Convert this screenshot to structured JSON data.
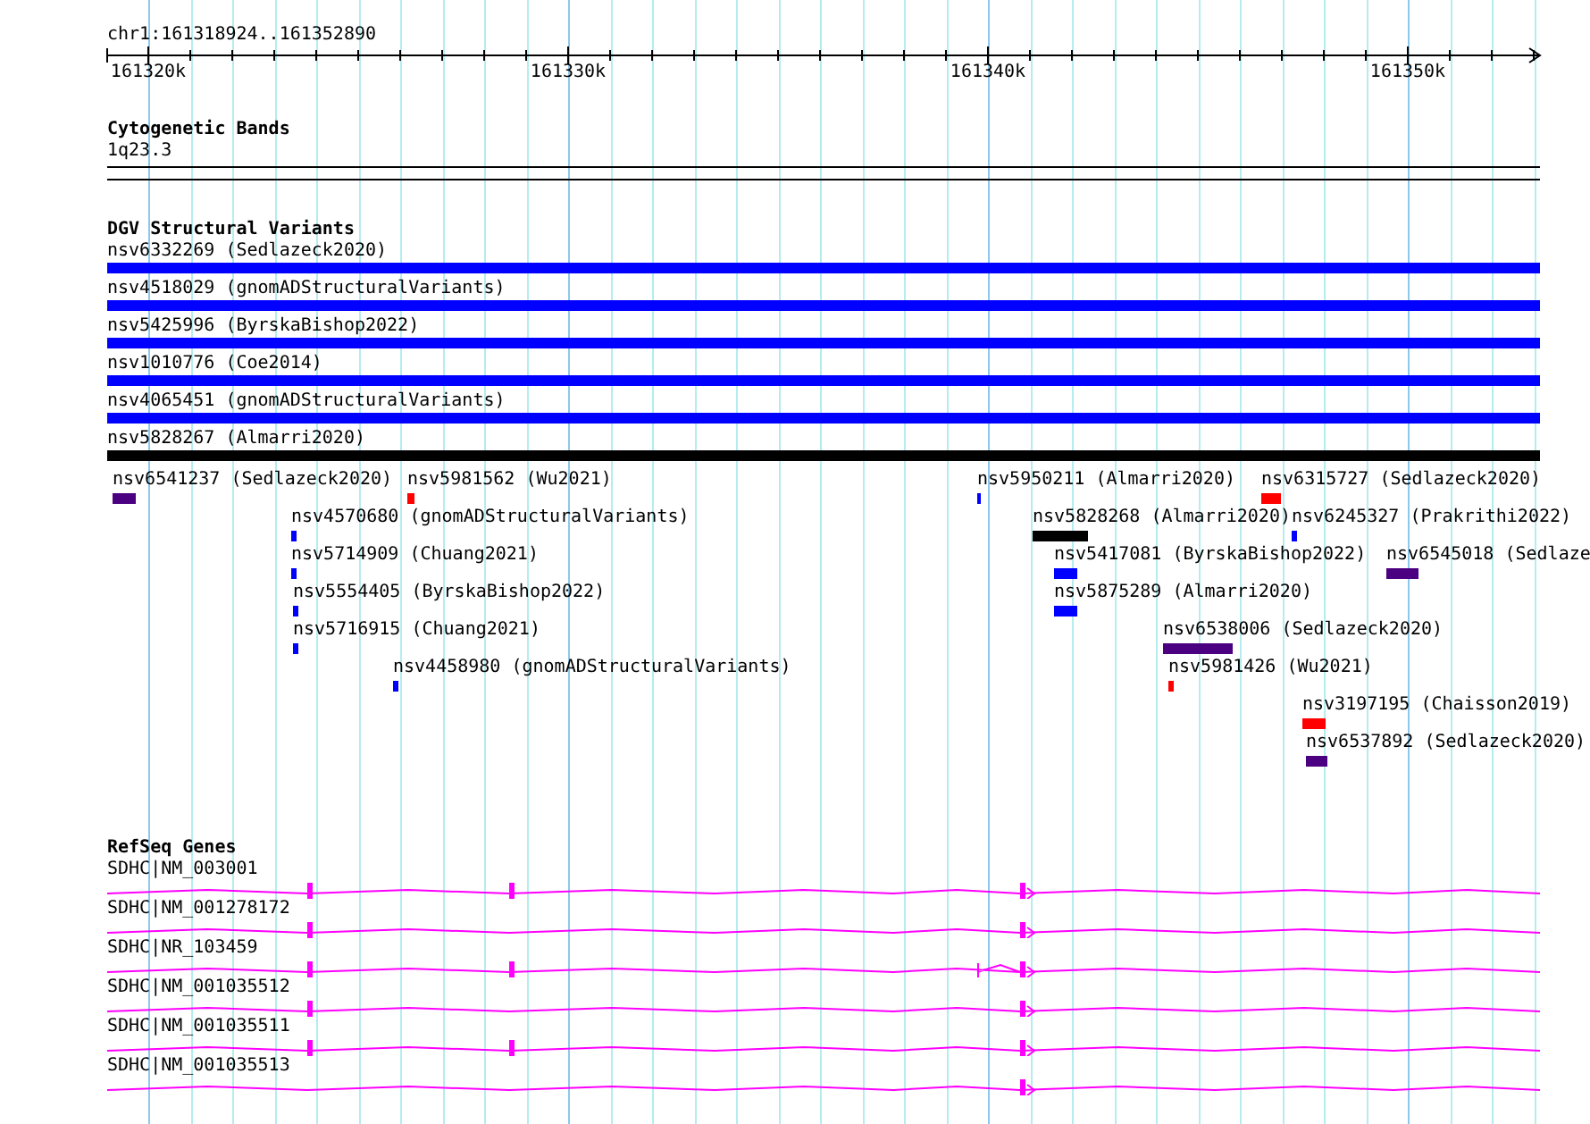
{
  "ruler": {
    "location": "chr1:161318924..161352890",
    "ticks": [
      "161320k",
      "161330k",
      "161340k",
      "161350k"
    ]
  },
  "cytogenetic_bands": {
    "title": "Cytogenetic Bands",
    "bands": [
      {
        "name": "1q23.3"
      }
    ]
  },
  "dgv_structural_variants": {
    "title": "DGV Structural Variants",
    "spanning_variants": [
      {
        "label": "nsv6332269 (Sedlazeck2020)",
        "color": "#0000ff"
      },
      {
        "label": "nsv4518029 (gnomADStructuralVariants)",
        "color": "#0000ff"
      },
      {
        "label": "nsv5425996 (ByrskaBishop2022)",
        "color": "#0000ff"
      },
      {
        "label": "nsv1010776 (Coe2014)",
        "color": "#0000ff"
      },
      {
        "label": "nsv4065451 (gnomADStructuralVariants)",
        "color": "#0000ff"
      },
      {
        "label": "nsv5828267 (Almarri2020)",
        "color": "#000000"
      }
    ],
    "variants": [
      {
        "label": "nsv6541237 (Sedlazeck2020)",
        "color": "#4b0082"
      },
      {
        "label": "nsv5981562 (Wu2021)",
        "color": "#ff0000"
      },
      {
        "label": "nsv5950211 (Almarri2020)",
        "color": "#0000ff"
      },
      {
        "label": "nsv6315727 (Sedlazeck2020)",
        "color": "#ff0000"
      },
      {
        "label": "nsv4570680 (gnomADStructuralVariants)",
        "color": "#0000ff"
      },
      {
        "label": "nsv5828268 (Almarri2020)",
        "color": "#000000"
      },
      {
        "label": "nsv6245327 (Prakrithi2022)",
        "color": "#0000ff"
      },
      {
        "label": "nsv5714909 (Chuang2021)",
        "color": "#0000ff"
      },
      {
        "label": "nsv5417081 (ByrskaBishop2022)",
        "color": "#0000ff"
      },
      {
        "label": "nsv6545018 (Sedlaze",
        "color": "#4b0082"
      },
      {
        "label": "nsv5554405 (ByrskaBishop2022)",
        "color": "#0000ff"
      },
      {
        "label": "nsv5875289 (Almarri2020)",
        "color": "#0000ff"
      },
      {
        "label": "nsv5716915 (Chuang2021)",
        "color": "#0000ff"
      },
      {
        "label": "nsv6538006 (Sedlazeck2020)",
        "color": "#4b0082"
      },
      {
        "label": "nsv4458980 (gnomADStructuralVariants)",
        "color": "#0000ff"
      },
      {
        "label": "nsv5981426 (Wu2021)",
        "color": "#ff0000"
      },
      {
        "label": "nsv3197195 (Chaisson2019)",
        "color": "#ff0000"
      },
      {
        "label": "nsv6537892 (Sedlazeck2020)",
        "color": "#4b0082"
      }
    ]
  },
  "refseq_genes": {
    "title": "RefSeq Genes",
    "genes": [
      {
        "label": "SDHC|NM_003001"
      },
      {
        "label": "SDHC|NM_001278172"
      },
      {
        "label": "SDHC|NR_103459"
      },
      {
        "label": "SDHC|NM_001035512"
      },
      {
        "label": "SDHC|NM_001035511"
      },
      {
        "label": "SDHC|NM_001035513"
      }
    ]
  }
}
